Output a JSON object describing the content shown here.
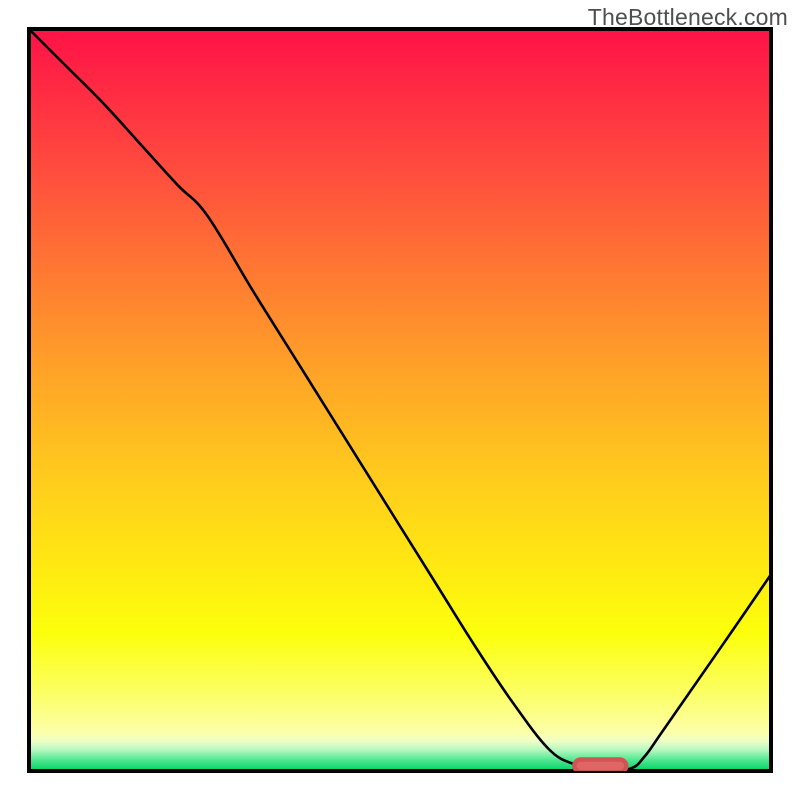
{
  "watermark": "TheBottleneck.com",
  "colors": {
    "curve": "#000000",
    "marker_fill": "#e06666",
    "gradient_top": "#ff1248",
    "gradient_bottom": "#00d166",
    "frame": "#000000"
  },
  "chart_data": {
    "type": "line",
    "title": "",
    "xlabel": "",
    "ylabel": "",
    "xlim": [
      0,
      100
    ],
    "ylim": [
      0,
      100
    ],
    "grid": false,
    "legend": false,
    "note": "Bottleneck-style curve with gradient background. Curve descends from top-left, passes through an inflection near x≈24, reaches minimum near x≈77, rises again toward right edge. Rounded marker sits at the valley floor.",
    "series": [
      {
        "name": "bottleneck_curve",
        "x": [
          0,
          5,
          10,
          15,
          20,
          24,
          30,
          35,
          40,
          45,
          50,
          55,
          60,
          65,
          70,
          73.5,
          77,
          81,
          83,
          85,
          90,
          95,
          100
        ],
        "y": [
          100,
          95.0,
          90.0,
          84.5,
          79.0,
          74.9,
          65.0,
          57.0,
          49.0,
          41.0,
          33.0,
          25.0,
          17.0,
          9.5,
          3.0,
          0.9,
          0.2,
          0.3,
          2.0,
          4.8,
          12.0,
          19.2,
          26.5
        ]
      }
    ],
    "marker": {
      "shape": "rounded-rect",
      "x_center": 77,
      "y_center": 0.7,
      "width": 7.0,
      "height": 1.7,
      "rx": 0.9
    }
  }
}
